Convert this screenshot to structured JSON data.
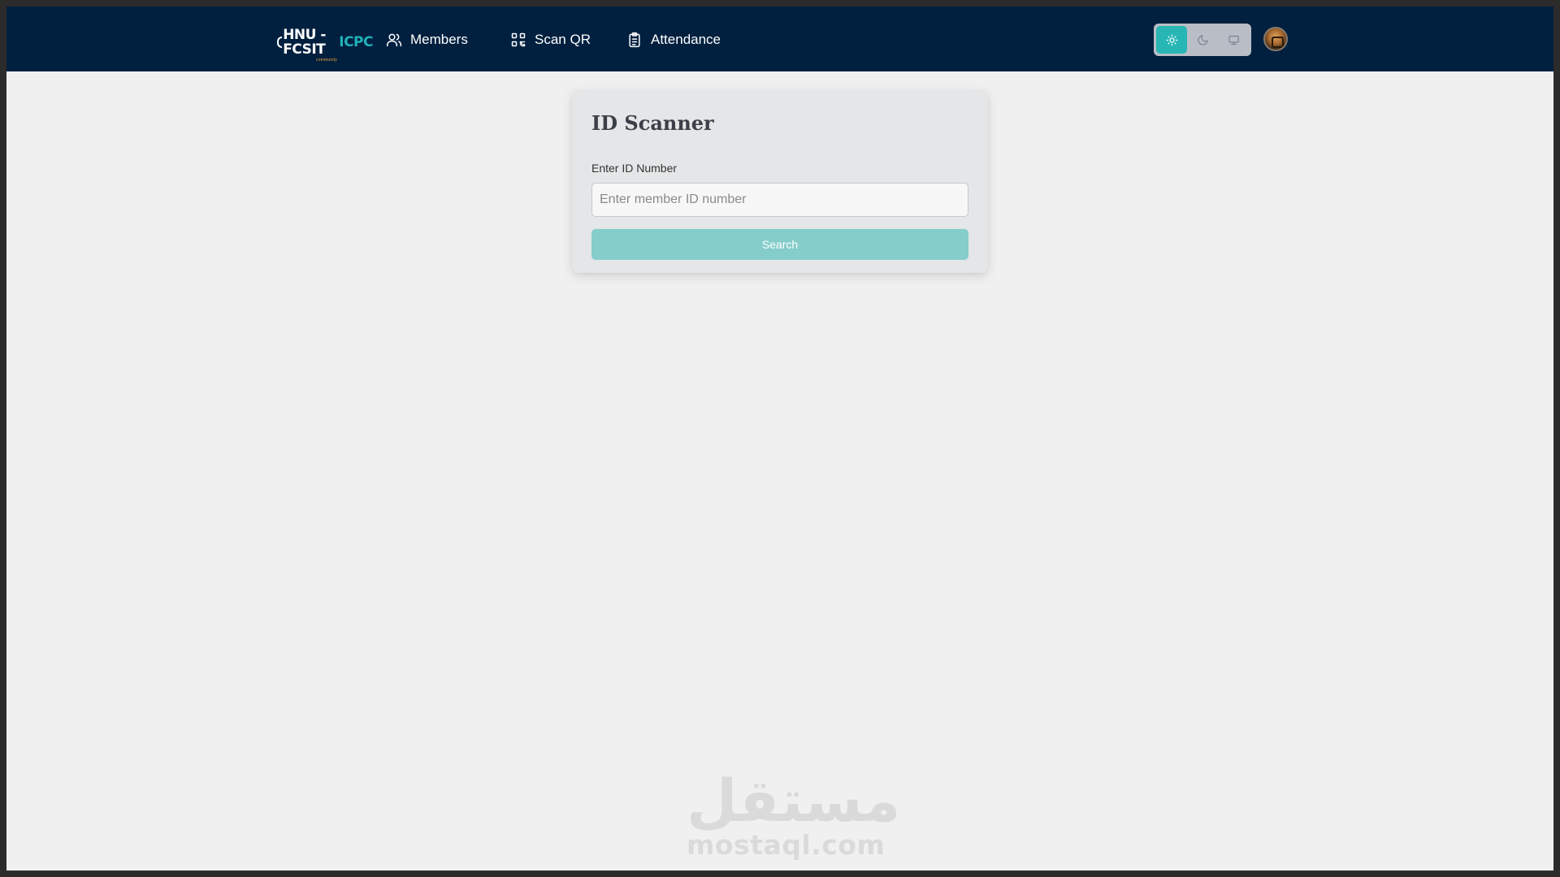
{
  "navbar": {
    "logo": {
      "main": "HNU - FCSIT",
      "accent": "ICPC",
      "sub": "community"
    },
    "items": [
      {
        "label": "Members",
        "icon": "users-icon"
      },
      {
        "label": "Scan QR",
        "icon": "qr-code-icon"
      },
      {
        "label": "Attendance",
        "icon": "clipboard-icon"
      }
    ],
    "theme": {
      "options": [
        "light",
        "dark",
        "system"
      ],
      "active": "light"
    },
    "avatar_icon": "user-avatar"
  },
  "card": {
    "title": "ID Scanner",
    "field_label": "Enter ID Number",
    "input_placeholder": "Enter member ID number",
    "input_value": "",
    "button_label": "Search"
  },
  "watermark": {
    "arabic": "مستقل",
    "latin": "mostaql.com"
  },
  "colors": {
    "navbar_bg": "#01203f",
    "accent": "#27b6b3",
    "button": "#84cdca",
    "page_bg": "#f0f0f0"
  }
}
